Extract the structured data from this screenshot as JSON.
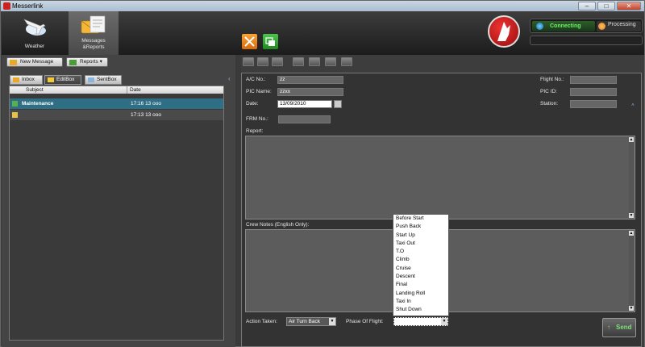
{
  "window": {
    "title": "Messerlink",
    "minimize": "–",
    "maximize": "□",
    "close": "✕"
  },
  "nav": {
    "weather": "Weather",
    "messages_line1": "Messages",
    "messages_line2": "&Reports"
  },
  "status": {
    "connecting": "Connecting",
    "processing": "Processing"
  },
  "left_toolbar": {
    "new_message": "New Message",
    "reports": "Reports"
  },
  "tabs": {
    "inbox": "Inbox",
    "editbox": "EditBox",
    "sentbox": "SentBox"
  },
  "list": {
    "col_subject": "Subject",
    "col_date": "Date",
    "rows": [
      {
        "subject": "Maintenance",
        "date": "17:16 13 ооо"
      },
      {
        "subject": "",
        "date": "17:13 13 ооо"
      }
    ]
  },
  "form": {
    "ac_no_label": "A/C No.:",
    "ac_no": "zz",
    "pic_name_label": "PIC Name:",
    "pic_name": "zzxx",
    "date_label": "Date:",
    "date": "13/09/2010",
    "flight_no_label": "Flight No.:",
    "flight_no": "",
    "pic_id_label": "PIC ID:",
    "pic_id": "",
    "station_label": "Station:",
    "station": "",
    "frm_no_label": "FRM No.:",
    "frm_no": "",
    "report_label": "Report:",
    "crew_notes_label": "Crew Notes (English Only):",
    "action_taken_label": "Action Taken:",
    "action_taken": "Air Turn Back",
    "phase_label": "Phase Of Flight:",
    "phase_value": "",
    "send": "Send"
  },
  "phase_options": [
    "Before Start",
    "Push Back",
    "Start Up",
    "Taxi Out",
    "T.O",
    "Climb",
    "Cruise",
    "Descent",
    "Final",
    "Landing Roll",
    "Taxi In",
    "Shut Down"
  ],
  "colors": {
    "accent_blue": "#2f6f86",
    "brand_red": "#c41a1a",
    "connect_green": "#6ef06a",
    "active_tab_gold": "#f3b93a"
  }
}
